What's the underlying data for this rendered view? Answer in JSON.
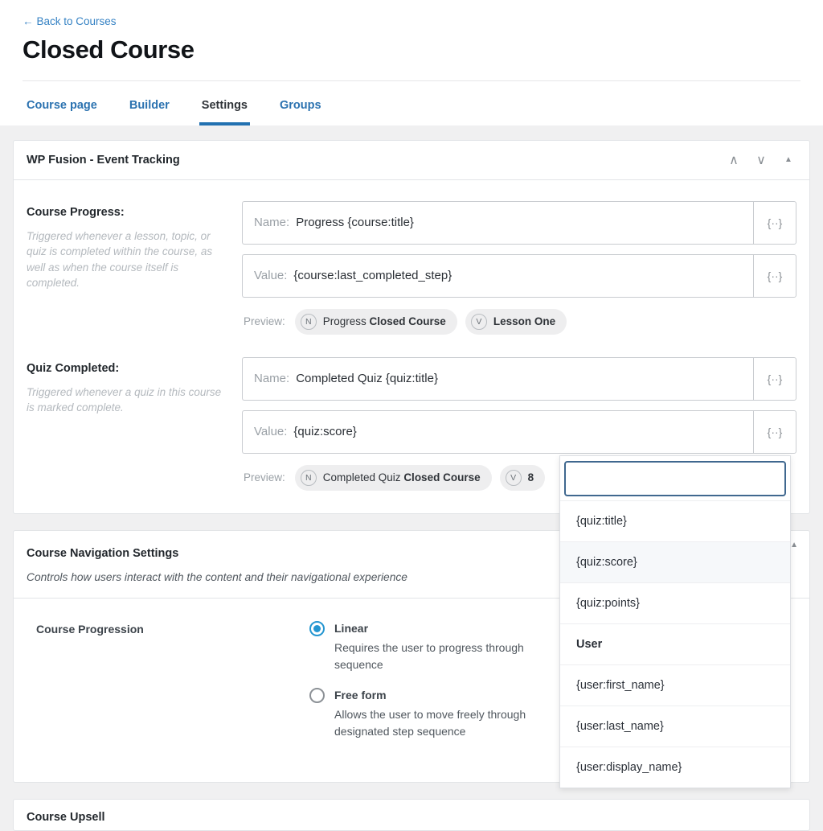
{
  "header": {
    "back_link": "Back to Courses",
    "back_arrow": "←",
    "title": "Closed Course",
    "tabs": [
      {
        "label": "Course page",
        "active": false
      },
      {
        "label": "Builder",
        "active": false
      },
      {
        "label": "Settings",
        "active": true
      },
      {
        "label": "Groups",
        "active": false
      }
    ]
  },
  "event_panel": {
    "title": "WP Fusion - Event Tracking",
    "actions": {
      "move_up": "∧",
      "move_down": "∨",
      "collapse": "▲"
    },
    "events": [
      {
        "label": "Course Progress:",
        "description": "Triggered whenever a lesson, topic, or quiz is completed within the course, as well as when the course itself is completed.",
        "name_prefix": "Name:",
        "name_value": "Progress {course:title}",
        "value_prefix": "Value:",
        "value_value": "{course:last_completed_step}",
        "merge_btn": "{··}",
        "preview_label": "Preview:",
        "preview_name_badge": "N",
        "preview_name_plain": "Progress ",
        "preview_name_strong": "Closed Course",
        "preview_value_badge": "V",
        "preview_value_text": "Lesson One"
      },
      {
        "label": "Quiz Completed:",
        "description": "Triggered whenever a quiz in this course is marked complete.",
        "name_prefix": "Name:",
        "name_value": "Completed Quiz {quiz:title}",
        "value_prefix": "Value:",
        "value_value": "{quiz:score}",
        "merge_btn": "{··}",
        "preview_label": "Preview:",
        "preview_name_badge": "N",
        "preview_name_plain": "Completed Quiz ",
        "preview_name_strong": "Closed Course",
        "preview_value_badge": "V",
        "preview_value_text": "8"
      }
    ]
  },
  "merge_dropdown": {
    "search_value": "",
    "items": [
      {
        "label": "{quiz:title}",
        "type": "item",
        "selected": false
      },
      {
        "label": "{quiz:score}",
        "type": "item",
        "selected": true
      },
      {
        "label": "{quiz:points}",
        "type": "item",
        "selected": false
      },
      {
        "label": "User",
        "type": "group",
        "selected": false
      },
      {
        "label": "{user:first_name}",
        "type": "item",
        "selected": false
      },
      {
        "label": "{user:last_name}",
        "type": "item",
        "selected": false
      },
      {
        "label": "{user:display_name}",
        "type": "item",
        "selected": false
      }
    ]
  },
  "nav_panel": {
    "title": "Course Navigation Settings",
    "subtitle": "Controls how users interact with the content and their navigational experience",
    "collapse": "▲",
    "setting_name": "Course Progression",
    "options": [
      {
        "title": "Linear",
        "description": "Requires the user to progress through sequence",
        "checked": true
      },
      {
        "title": "Free form",
        "description": "Allows the user to move freely through designated step sequence",
        "checked": false
      }
    ]
  },
  "bottom_panel": {
    "title": "Course Upsell"
  }
}
